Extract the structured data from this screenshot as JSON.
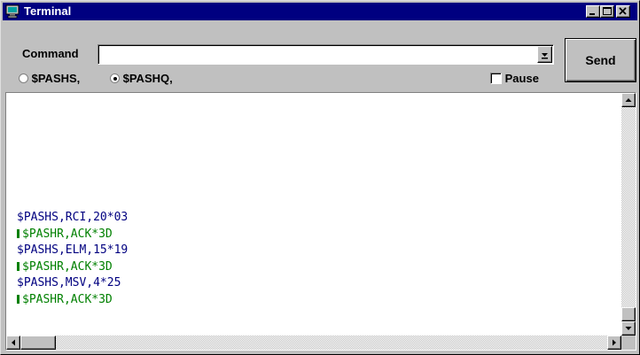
{
  "window": {
    "title": "Terminal",
    "controls": [
      "minimize-icon",
      "maximize-icon",
      "close-icon"
    ]
  },
  "command": {
    "label": "Command",
    "value": "",
    "placeholder": ""
  },
  "send_button": {
    "label": "Send"
  },
  "options": {
    "radio_pashs": {
      "label": "$PASHS,",
      "selected": false
    },
    "radio_pashq": {
      "label": "$PASHQ,",
      "selected": true
    },
    "pause": {
      "label": "Pause",
      "checked": false
    }
  },
  "terminal": {
    "lines": [
      {
        "text": "$PASHS,RCI,20*03",
        "kind": "sent"
      },
      {
        "text": "$PASHR,ACK*3D",
        "kind": "received"
      },
      {
        "text": "$PASHS,ELM,15*19",
        "kind": "sent"
      },
      {
        "text": "$PASHR,ACK*3D",
        "kind": "received"
      },
      {
        "text": "$PASHS,MSV,4*25",
        "kind": "sent"
      },
      {
        "text": "$PASHR,ACK*3D",
        "kind": "received"
      }
    ]
  },
  "colors": {
    "titlebar": "#000080",
    "sent_text": "#000080",
    "received_text": "#008000",
    "face": "#c0c0c0"
  }
}
